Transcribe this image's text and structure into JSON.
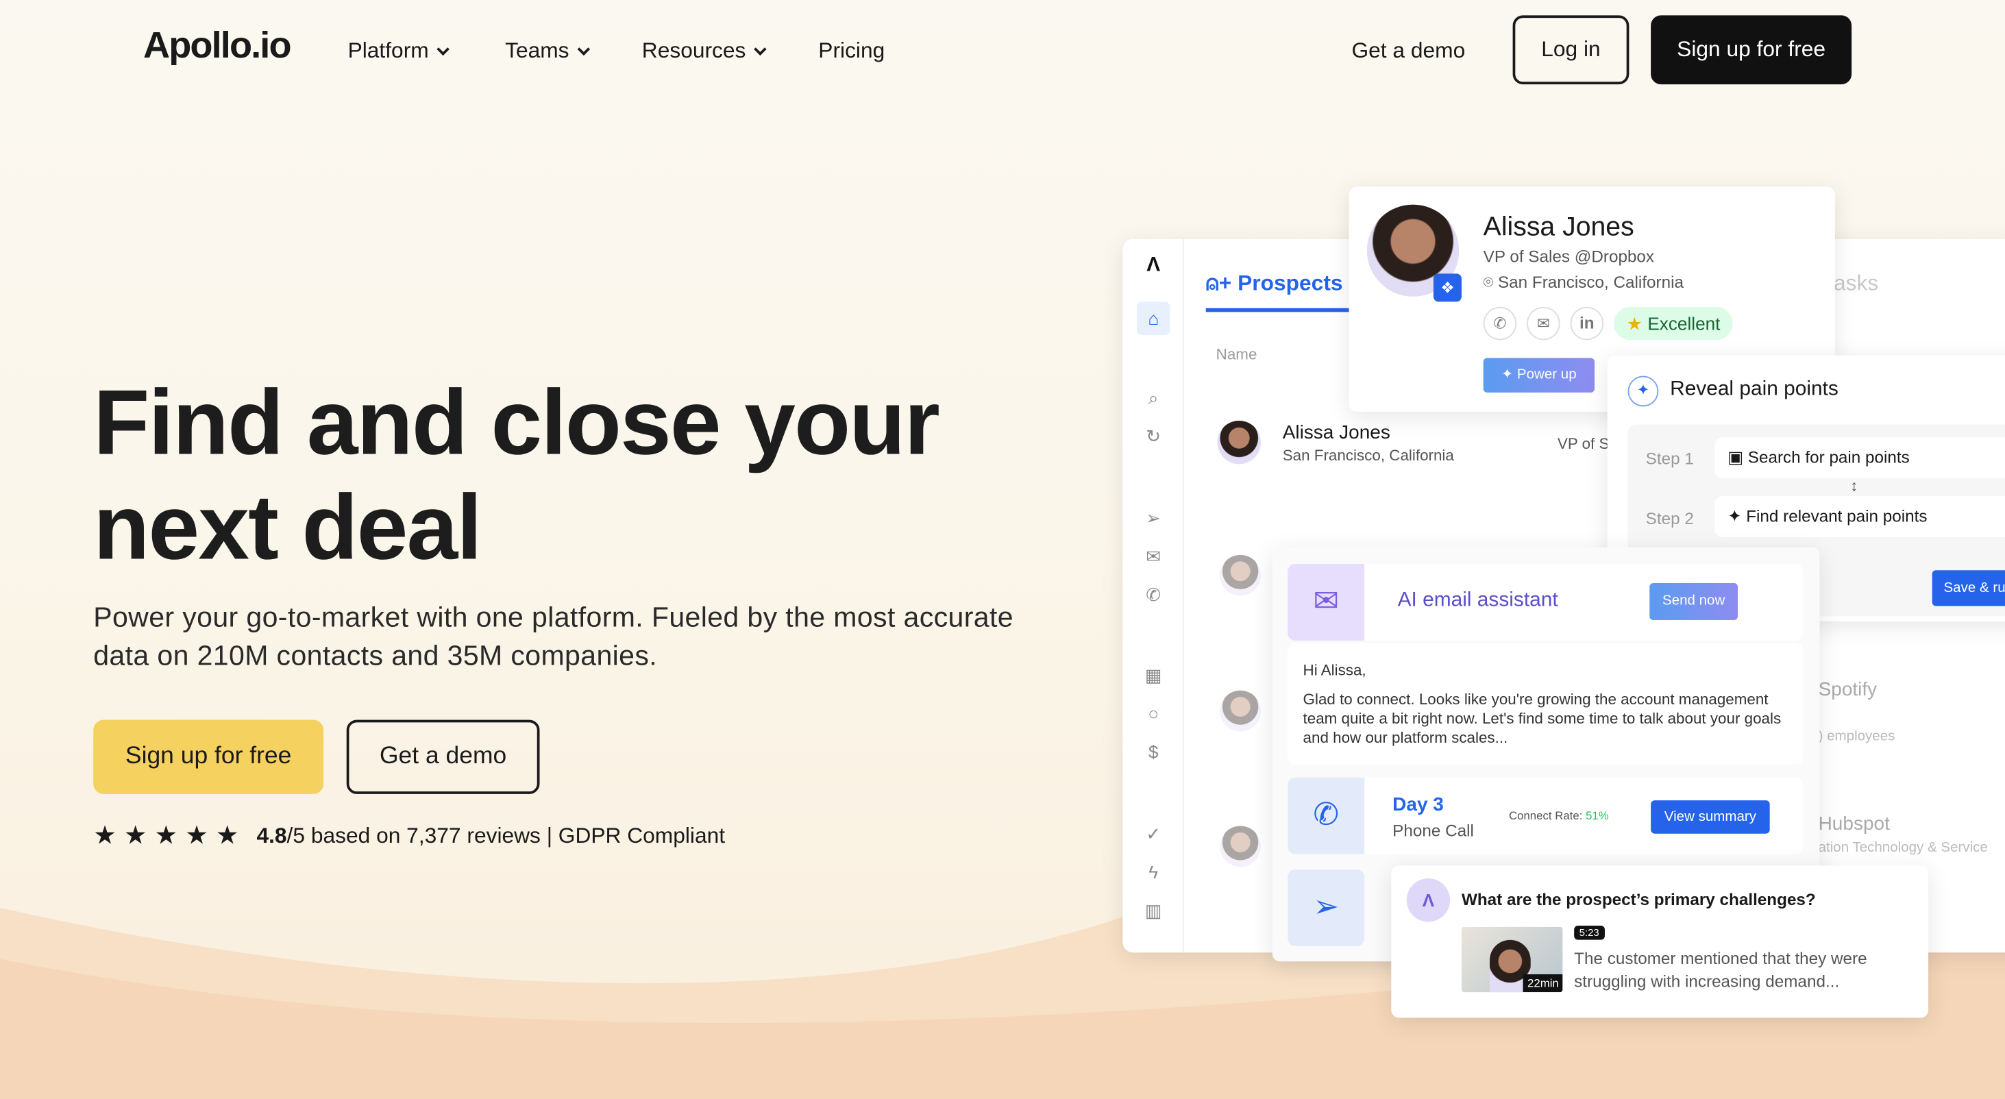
{
  "nav": {
    "logo": "Apollo.io",
    "items": [
      {
        "label": "Platform"
      },
      {
        "label": "Teams"
      },
      {
        "label": "Resources"
      },
      {
        "label": "Pricing"
      }
    ],
    "get_demo": "Get a demo",
    "login": "Log in",
    "signup": "Sign up for free"
  },
  "hero": {
    "title_line1": "Find and close your",
    "title_line2": "next deal",
    "subtitle": "Power your go-to-market with one platform. Fueled by the most accurate data on 210M contacts and 35M companies.",
    "signup": "Sign up for free",
    "demo": "Get a demo",
    "rating": "4.8",
    "rating_suffix": "/5 based on 7,377 reviews | GDPR Compliant",
    "stars": 5
  },
  "app": {
    "tab_prospects": "Prospects",
    "tab_tasks": "asks",
    "col_name": "Name",
    "row1": {
      "name": "Alissa Jones",
      "location": "San Francisco, California",
      "title": "VP of S"
    },
    "row_spotify": "Spotify",
    "row_spotify_sub": ") employees",
    "row_hubspot": "Hubspot",
    "row_hubspot_sub": "ation Technology & Service"
  },
  "profile": {
    "name": "Alissa Jones",
    "title": "VP of Sales @Dropbox",
    "location": "San Francisco, California",
    "badge": "Excellent",
    "linkedin": "in",
    "power_up": "Power up"
  },
  "pain": {
    "title": "Reveal pain points",
    "step1_label": "Step 1",
    "step1": "Search for pain points",
    "step2_label": "Step 2",
    "step2": "Find relevant pain points",
    "save": "Save & ru"
  },
  "email": {
    "title": "AI email assistant",
    "send": "Send now",
    "greeting": "Hi Alissa,",
    "body": "Glad to connect. Looks like you're growing the account management team quite a bit right now. Let's find some time to talk about your goals and how our platform scales..."
  },
  "call": {
    "day": "Day 3",
    "type": "Phone Call",
    "rate_label": "Connect Rate:",
    "rate": "51%",
    "view": "View summary"
  },
  "ai": {
    "question": "What are the prospect’s primary challenges?",
    "timestamp": "5:23",
    "duration": "22min",
    "answer": "The customer mentioned that they were struggling with increasing demand..."
  },
  "colors": {
    "accent": "#2563eb",
    "yellow": "#f5d160",
    "purple": "#7c5ce0",
    "green": "#22c55e"
  }
}
